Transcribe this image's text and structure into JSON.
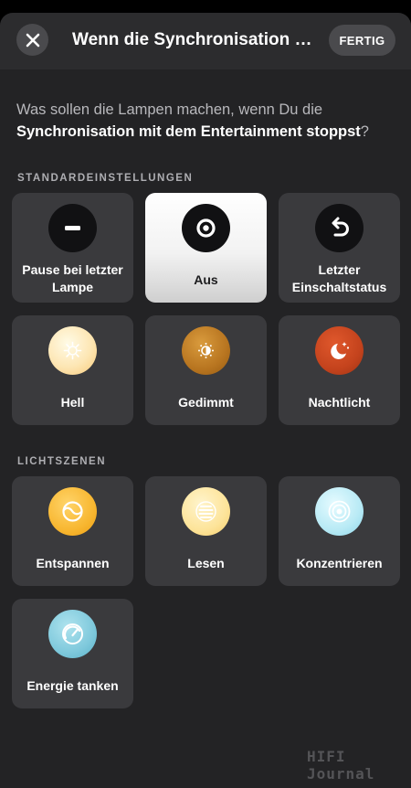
{
  "header": {
    "title": "Wenn die Synchronisation stoppt",
    "done_label": "FERTIG"
  },
  "question": {
    "prefix": "Was sollen die Lampen machen, wenn Du die",
    "emphasis": "Synchronisation mit dem Entertainment stoppst",
    "suffix": "?"
  },
  "sections": {
    "defaults_label": "STANDARDEINSTELLUNGEN",
    "scenes_label": "LICHTSZENEN"
  },
  "defaults": [
    {
      "label": "Pause bei letzter Lampe",
      "icon": "pause-icon",
      "selected": false
    },
    {
      "label": "Aus",
      "icon": "off-icon",
      "selected": true
    },
    {
      "label": "Letzter Einschaltstatus",
      "icon": "undo-icon",
      "selected": false
    },
    {
      "label": "Hell",
      "icon": "sun-bright-icon",
      "selected": false
    },
    {
      "label": "Gedimmt",
      "icon": "sun-dim-icon",
      "selected": false
    },
    {
      "label": "Nachtlicht",
      "icon": "moon-stars-icon",
      "selected": false
    }
  ],
  "scenes": [
    {
      "label": "Entspannen",
      "icon": "relax-icon"
    },
    {
      "label": "Lesen",
      "icon": "read-icon"
    },
    {
      "label": "Konzentrieren",
      "icon": "concentrate-icon"
    },
    {
      "label": "Energie tanken",
      "icon": "energize-icon"
    }
  ],
  "watermark": "HIFI Journal"
}
